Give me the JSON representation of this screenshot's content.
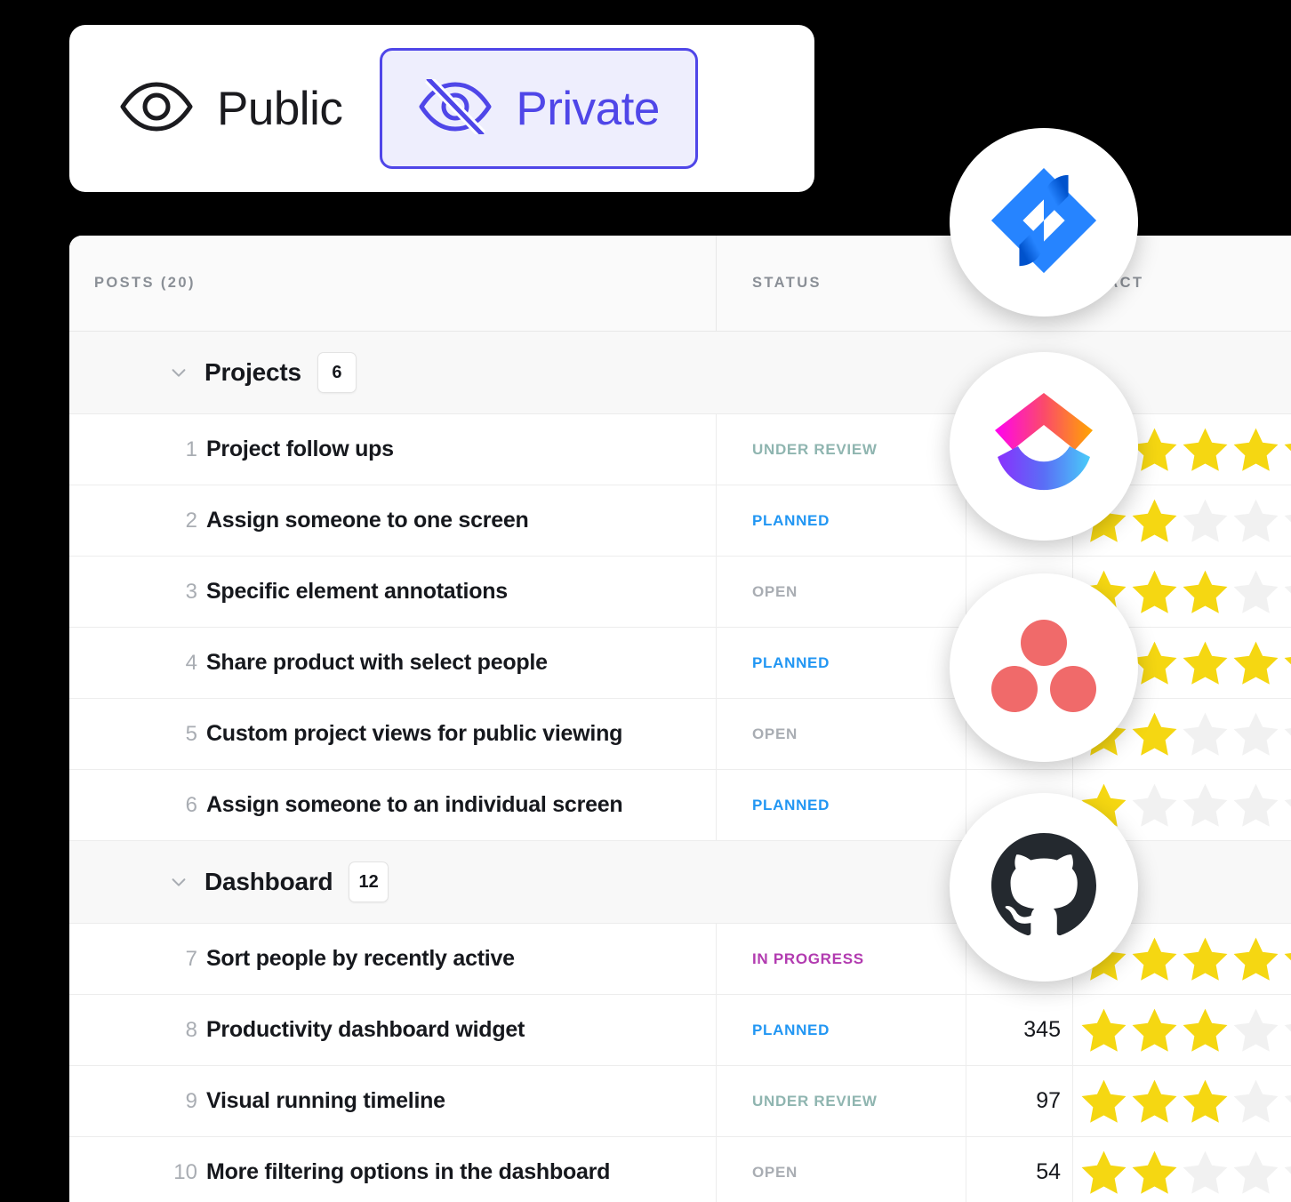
{
  "visibility_toggle": {
    "public": {
      "label": "Public",
      "icon": "eye-icon",
      "selected": false
    },
    "private": {
      "label": "Private",
      "icon": "eye-off-icon",
      "selected": true
    },
    "accent_color": "#4f46e8",
    "active_bg_color": "#eeeefd"
  },
  "table": {
    "headers": {
      "posts": "POSTS (20)",
      "status": "STATUS",
      "votes": "",
      "impact": "IMPACT"
    },
    "groups": [
      {
        "name": "Projects",
        "count": "6",
        "expanded": true,
        "rows": [
          {
            "rank": "1",
            "title": "Project follow ups",
            "status": "UNDER REVIEW",
            "status_key": "under",
            "votes": "",
            "stars": 5
          },
          {
            "rank": "2",
            "title": "Assign someone to one screen",
            "status": "PLANNED",
            "status_key": "planned",
            "votes": "",
            "stars": 2
          },
          {
            "rank": "3",
            "title": "Specific element annotations",
            "status": "OPEN",
            "status_key": "open",
            "votes": "",
            "stars": 3
          },
          {
            "rank": "4",
            "title": "Share product with select people",
            "status": "PLANNED",
            "status_key": "planned",
            "votes": "",
            "stars": 5
          },
          {
            "rank": "5",
            "title": "Custom project views for public viewing",
            "status": "OPEN",
            "status_key": "open",
            "votes": "",
            "stars": 2
          },
          {
            "rank": "6",
            "title": "Assign someone to an individual screen",
            "status": "PLANNED",
            "status_key": "planned",
            "votes": "",
            "stars": 1
          }
        ]
      },
      {
        "name": "Dashboard",
        "count": "12",
        "expanded": true,
        "rows": [
          {
            "rank": "7",
            "title": "Sort people by recently active",
            "status": "IN PROGRESS",
            "status_key": "progress",
            "votes": "",
            "stars": 5
          },
          {
            "rank": "8",
            "title": "Productivity dashboard widget",
            "status": "PLANNED",
            "status_key": "planned",
            "votes": "345",
            "stars": 3
          },
          {
            "rank": "9",
            "title": "Visual running timeline",
            "status": "UNDER REVIEW",
            "status_key": "under",
            "votes": "97",
            "stars": 3
          },
          {
            "rank": "10",
            "title": "More filtering options in the dashboard",
            "status": "OPEN",
            "status_key": "open",
            "votes": "54",
            "stars": 2
          }
        ]
      }
    ],
    "status_colors": {
      "under": "#8fb5b0",
      "planned": "#2196f3",
      "open": "#a9adb3",
      "progress": "#b23bb0"
    },
    "star_filled_color": "#f5d712",
    "star_empty_color": "#f1f1f1"
  },
  "app_logos": [
    {
      "id": "jira",
      "name": "jira-logo-icon"
    },
    {
      "id": "clickup",
      "name": "clickup-logo-icon"
    },
    {
      "id": "asana",
      "name": "asana-logo-icon"
    },
    {
      "id": "github",
      "name": "github-logo-icon"
    }
  ]
}
